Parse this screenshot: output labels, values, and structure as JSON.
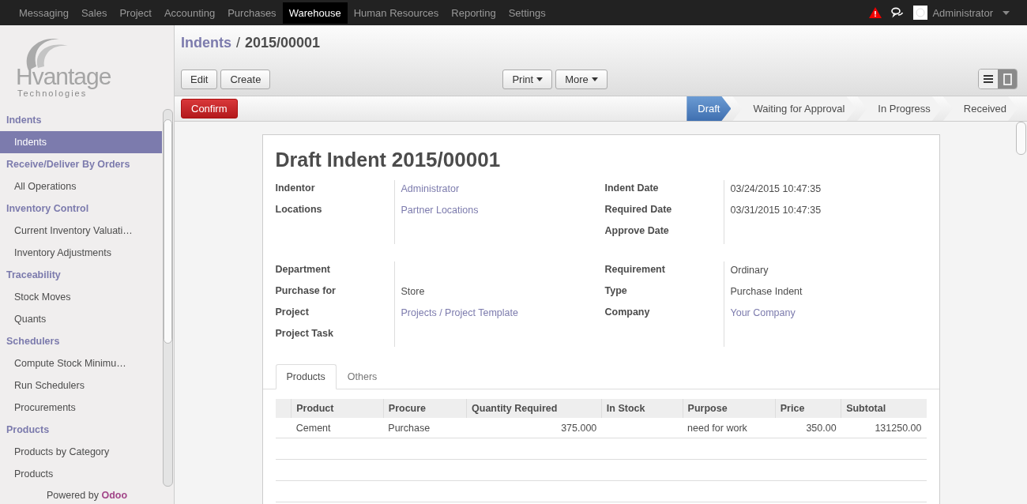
{
  "top_menu": [
    {
      "label": "Messaging",
      "selected": false
    },
    {
      "label": "Sales",
      "selected": false
    },
    {
      "label": "Project",
      "selected": false
    },
    {
      "label": "Accounting",
      "selected": false
    },
    {
      "label": "Purchases",
      "selected": false
    },
    {
      "label": "Warehouse",
      "selected": true
    },
    {
      "label": "Human Resources",
      "selected": false
    },
    {
      "label": "Reporting",
      "selected": false
    },
    {
      "label": "Settings",
      "selected": false
    }
  ],
  "user": "Administrator",
  "logo": {
    "name": "Hvantage",
    "tagline": "Technologies"
  },
  "sidebar": [
    {
      "title": "Indents",
      "items": [
        {
          "label": "Indents",
          "selected": true
        }
      ]
    },
    {
      "title": "Receive/Deliver By Orders",
      "items": [
        {
          "label": "All Operations",
          "selected": false
        }
      ]
    },
    {
      "title": "Inventory Control",
      "items": [
        {
          "label": "Current Inventory Valuati…",
          "selected": false
        },
        {
          "label": "Inventory Adjustments",
          "selected": false
        }
      ]
    },
    {
      "title": "Traceability",
      "items": [
        {
          "label": "Stock Moves",
          "selected": false
        },
        {
          "label": "Quants",
          "selected": false
        }
      ]
    },
    {
      "title": "Schedulers",
      "items": [
        {
          "label": "Compute Stock Minimu…",
          "selected": false
        },
        {
          "label": "Run Schedulers",
          "selected": false
        },
        {
          "label": "Procurements",
          "selected": false
        }
      ]
    },
    {
      "title": "Products",
      "items": [
        {
          "label": "Products by Category",
          "selected": false
        },
        {
          "label": "Products",
          "selected": false
        }
      ]
    }
  ],
  "footer": {
    "text": "Powered by",
    "brand": "Odoo"
  },
  "breadcrumb": {
    "parent": "Indents",
    "separator": "/",
    "current": "2015/00001"
  },
  "left_buttons": [
    "Edit",
    "Create"
  ],
  "dropdowns": [
    "Print",
    "More"
  ],
  "view_switch": [
    {
      "kind": "list",
      "selected": false
    },
    {
      "kind": "form",
      "selected": true
    }
  ],
  "confirm": "Confirm",
  "stages": [
    {
      "label": "Draft",
      "selected": true
    },
    {
      "label": "Waiting for Approval",
      "selected": false
    },
    {
      "label": "In Progress",
      "selected": false
    },
    {
      "label": "Received",
      "selected": false
    }
  ],
  "form": {
    "title": "Draft Indent",
    "number": "2015/00001",
    "groups": [
      {
        "left": [
          {
            "label": "Indentor",
            "value": "Administrator",
            "link": true
          },
          {
            "label": "Locations",
            "value": "Partner Locations",
            "link": true
          }
        ],
        "right": [
          {
            "label": "Indent Date",
            "value": "03/24/2015 10:47:35",
            "link": false
          },
          {
            "label": "Required Date",
            "value": "03/31/2015 10:47:35",
            "link": false
          },
          {
            "label": "Approve Date"
          }
        ]
      },
      {
        "left": [
          {
            "label": "Department"
          },
          {
            "label": "Purchase for",
            "value": "Store",
            "link": false
          },
          {
            "label": "Project",
            "value": "Projects / Project Template",
            "link": true
          },
          {
            "label": "Project Task"
          }
        ],
        "right": [
          {
            "label": "Requirement",
            "value": "Ordinary",
            "link": false
          },
          {
            "label": "Type",
            "value": "Purchase Indent",
            "link": false
          },
          {
            "label": "Company",
            "value": "Your Company",
            "link": true
          }
        ]
      }
    ]
  },
  "tabs": [
    {
      "label": "Products",
      "selected": true
    },
    {
      "label": "Others",
      "selected": false
    }
  ],
  "table": {
    "columns": [
      {
        "label": "Product",
        "numeric": false
      },
      {
        "label": "Procure",
        "numeric": false
      },
      {
        "label": "Quantity Required",
        "numeric": true
      },
      {
        "label": "In Stock"
      },
      {
        "label": "Purpose",
        "numeric": false
      },
      {
        "label": "Price",
        "numeric": true
      },
      {
        "label": "Subtotal",
        "numeric": true
      }
    ],
    "rows": [
      [
        "Cement",
        "Purchase",
        "375.000",
        "",
        "need for work",
        "350.00",
        "131250.00"
      ]
    ]
  }
}
